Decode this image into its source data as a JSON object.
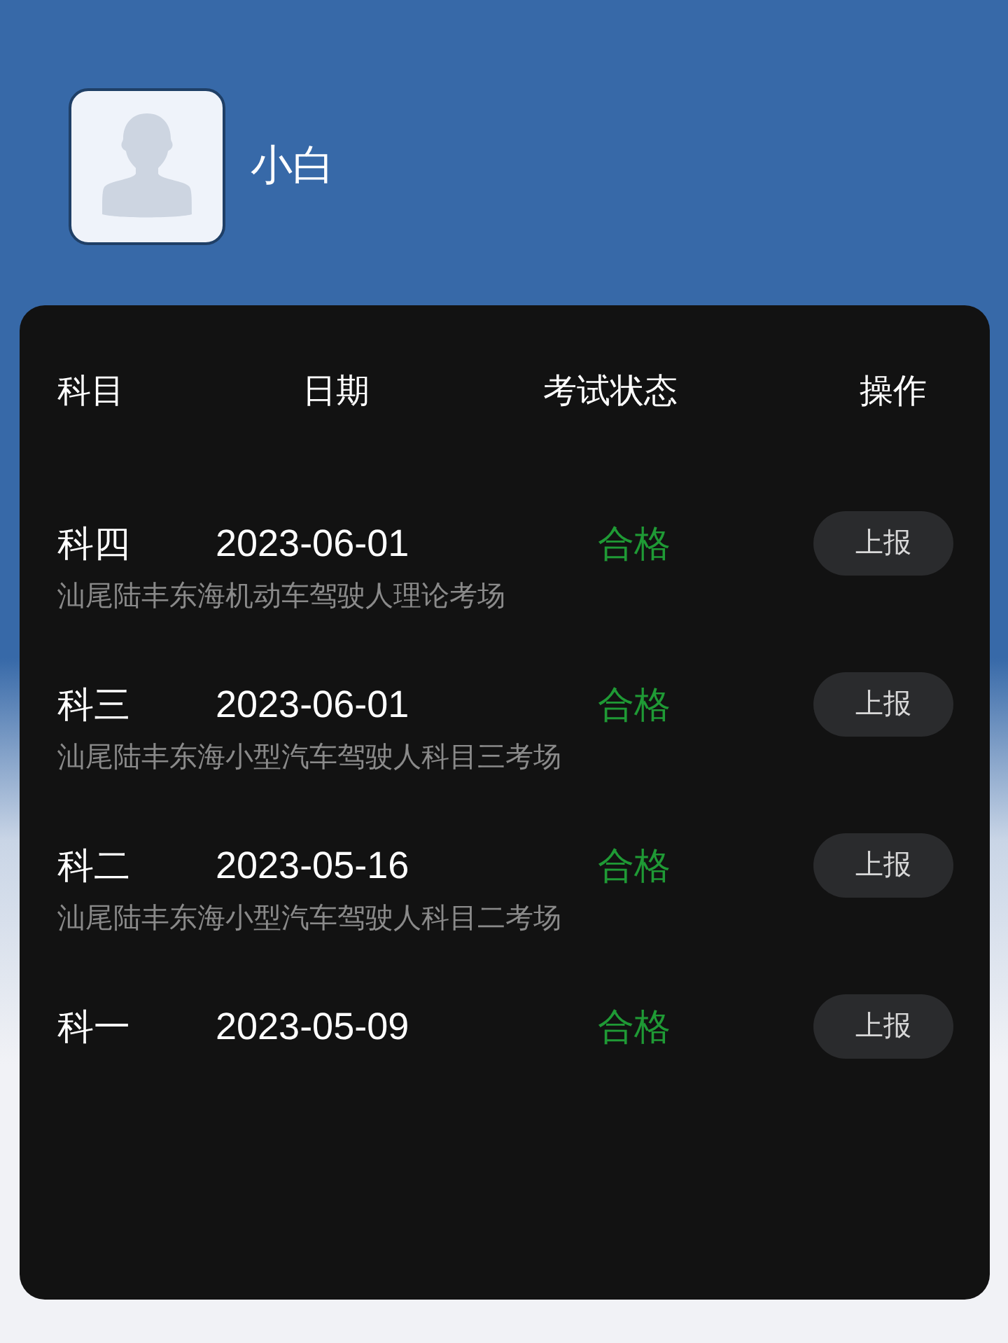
{
  "profile": {
    "name": "小白"
  },
  "table": {
    "columns": [
      "科目",
      "日期",
      "考试状态",
      "操作"
    ],
    "rows": [
      {
        "subject": "科四",
        "date": "2023-06-01",
        "status": "合格",
        "color": "#1f9a35",
        "location": "汕尾陆丰东海机动车驾驶人理论考场",
        "action": "上报"
      },
      {
        "subject": "科三",
        "date": "2023-06-01",
        "status": "合格",
        "color": "#1f9a35",
        "location": "汕尾陆丰东海小型汽车驾驶人科目三考场",
        "action": "上报"
      },
      {
        "subject": "科二",
        "date": "2023-05-16",
        "status": "合格",
        "color": "#1f9a35",
        "location": "汕尾陆丰东海小型汽车驾驶人科目二考场",
        "action": "上报"
      },
      {
        "subject": "科一",
        "date": "2023-05-09",
        "status": "合格",
        "color": "#1f9a35",
        "action": "上报"
      }
    ]
  }
}
